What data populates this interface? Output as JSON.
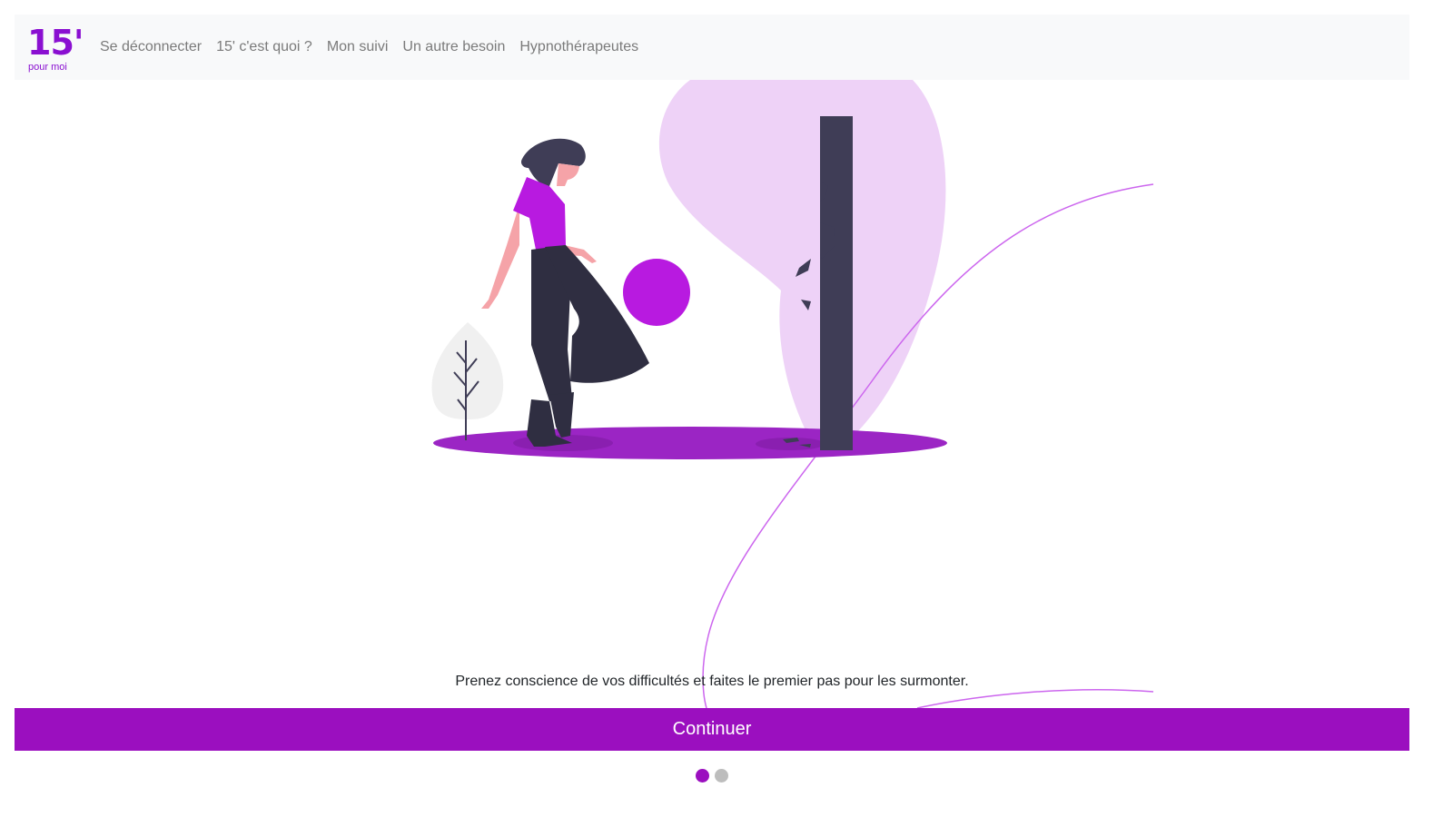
{
  "logo": {
    "main": "15'",
    "sub": "pour moi"
  },
  "nav": {
    "items": [
      {
        "label": "Se déconnecter"
      },
      {
        "label": "15' c'est quoi ?"
      },
      {
        "label": "Mon suivi"
      },
      {
        "label": "Un autre besoin"
      },
      {
        "label": "Hypnothérapeutes"
      }
    ]
  },
  "main": {
    "tagline": "Prenez conscience de vos difficultés et faites le premier pas pour les surmonter.",
    "continue_label": "Continuer"
  },
  "pagination": {
    "total": 2,
    "active_index": 0
  },
  "colors": {
    "accent": "#9b0fbf",
    "logo": "#8a0fd1",
    "navbar_bg": "#f8f9fa",
    "nav_text": "#7a7a7a",
    "dot_inactive": "#bdbdbd",
    "blob": "#eed2f7",
    "dark": "#3f3d56"
  }
}
